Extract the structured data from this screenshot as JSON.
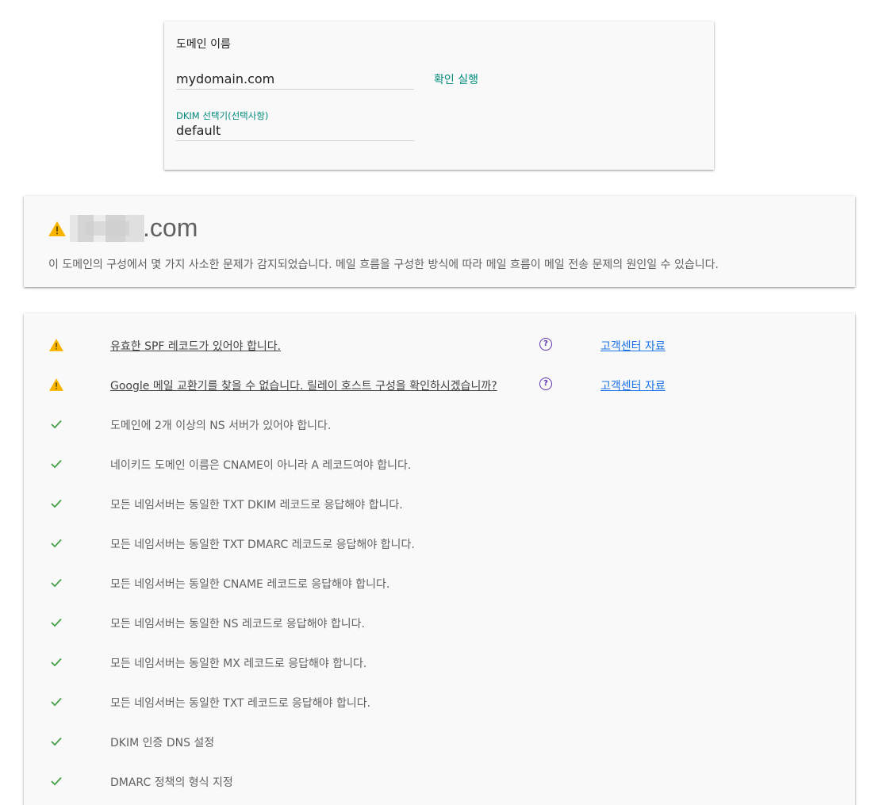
{
  "form": {
    "title": "도메인 이름",
    "domain_value": "mydomain.com",
    "verify_label": "확인 실행",
    "dkim_label": "DKIM 선택기(선택사항)",
    "dkim_value": "default"
  },
  "summary": {
    "domain_suffix": ".com",
    "message": "이 도메인의 구성에서 몇 가지 사소한 문제가 감지되었습니다. 메일 흐름을 구성한 방식에 따라 메일 흐름이 메일 전송 문제의 원인일 수 있습니다.",
    "status_icon": "warning-icon"
  },
  "checks": [
    {
      "status": "warning",
      "icon": "warning-icon",
      "text": "유효한 SPF 레코드가 있어야 합니다.",
      "help_icon": "help-circle-icon",
      "help_label": "고객센터 자료"
    },
    {
      "status": "warning",
      "icon": "warning-icon",
      "text": "Google 메일 교환기를 찾을 수 없습니다. 릴레이 호스트 구성을 확인하시겠습니까?",
      "help_icon": "help-circle-icon",
      "help_label": "고객센터 자료"
    },
    {
      "status": "ok",
      "icon": "check-icon",
      "text": "도메인에 2개 이상의 NS 서버가 있어야 합니다."
    },
    {
      "status": "ok",
      "icon": "check-icon",
      "text": "네이키드 도메인 이름은 CNAME이 아니라 A 레코드여야 합니다."
    },
    {
      "status": "ok",
      "icon": "check-icon",
      "text": "모든 네임서버는 동일한 TXT DKIM 레코드로 응답해야 합니다."
    },
    {
      "status": "ok",
      "icon": "check-icon",
      "text": "모든 네임서버는 동일한 TXT DMARC 레코드로 응답해야 합니다."
    },
    {
      "status": "ok",
      "icon": "check-icon",
      "text": "모든 네임서버는 동일한 CNAME 레코드로 응답해야 합니다."
    },
    {
      "status": "ok",
      "icon": "check-icon",
      "text": "모든 네임서버는 동일한 NS 레코드로 응답해야 합니다."
    },
    {
      "status": "ok",
      "icon": "check-icon",
      "text": "모든 네임서버는 동일한 MX 레코드로 응답해야 합니다."
    },
    {
      "status": "ok",
      "icon": "check-icon",
      "text": "모든 네임서버는 동일한 TXT 레코드로 응답해야 합니다."
    },
    {
      "status": "ok",
      "icon": "check-icon",
      "text": "DKIM 인증 DNS 설정"
    },
    {
      "status": "ok",
      "icon": "check-icon",
      "text": "DMARC 정책의 형식 지정"
    }
  ],
  "colors": {
    "accent": "#00897b",
    "warning": "#f9b400",
    "success": "#43a047",
    "help": "#5e35b1",
    "link": "#1a73e8"
  }
}
